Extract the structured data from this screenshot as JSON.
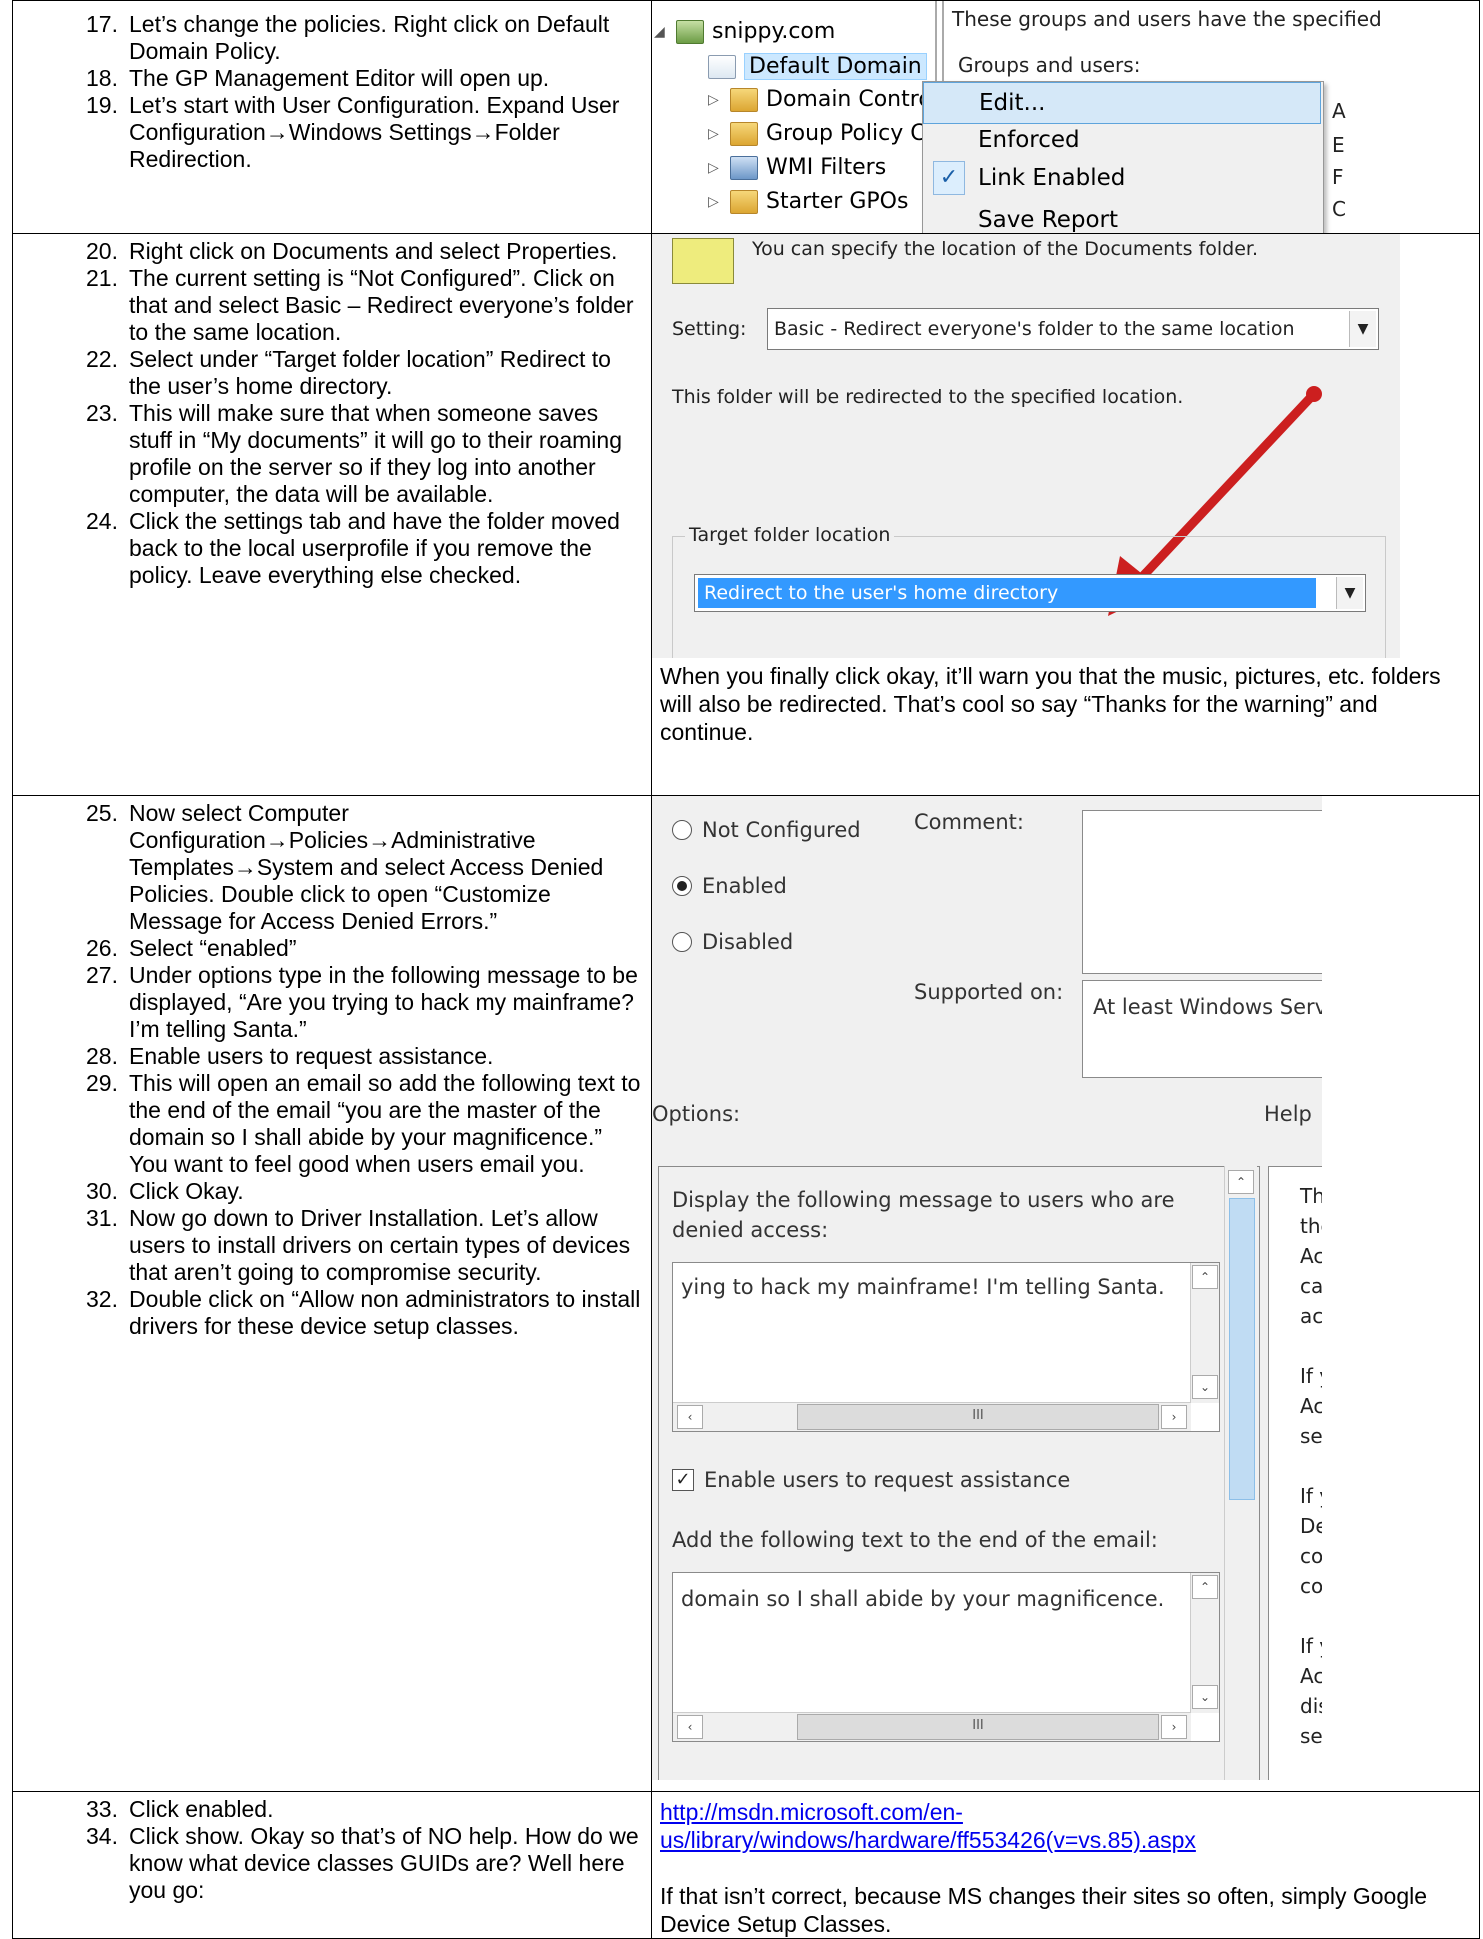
{
  "rows": [
    {
      "steps": [
        {
          "num": "17.",
          "text": "Let’s change the policies. Right click on Default Domain Policy."
        },
        {
          "num": "18.",
          "text": "The GP Management Editor will open up."
        },
        {
          "num": "19.",
          "text": "Let’s start with User Configuration. Expand User Configuration→Windows Settings→Folder Redirection."
        }
      ]
    },
    {
      "steps": [
        {
          "num": "20.",
          "text": "Right click on Documents and select Properties."
        },
        {
          "num": "21.",
          "text": "The current setting is “Not Configured”. Click on that and select Basic – Redirect everyone’s folder to the same location."
        },
        {
          "num": "22.",
          "text": "Select under “Target folder location” Redirect to the user’s home directory."
        },
        {
          "num": "23.",
          "text": "This will make sure that when someone saves stuff in “My documents” it will go to their roaming profile on the server so if they log into another computer, the data will be available."
        },
        {
          "num": "24.",
          "text": "Click the settings tab and have the folder moved back to the local userprofile if you remove the policy. Leave everything else checked."
        }
      ],
      "note": "When you finally click okay, it’ll warn you that the music, pictures, etc. folders will also be redirected. That’s cool so say “Thanks for the warning” and continue."
    },
    {
      "steps": [
        {
          "num": "25.",
          "text": "Now select Computer Configuration→Policies→Administrative Templates→System and select Access Denied Policies. Double click to open “Customize Message for Access Denied Errors.”"
        },
        {
          "num": "26.",
          "text": "Select “enabled”"
        },
        {
          "num": "27.",
          "text": "Under options type in the following message to be displayed, “Are you trying to hack my mainframe? I’m telling Santa.”"
        },
        {
          "num": "28.",
          "text": "Enable users to request assistance."
        },
        {
          "num": "29.",
          "text": "This will open an email so add the following text to the end of the email “you are the master of the domain so I shall abide by your magnificence.” You want to feel good when users email you."
        },
        {
          "num": "30.",
          "text": "Click Okay."
        },
        {
          "num": "31.",
          "text": "Now go down to Driver Installation. Let’s allow users to install drivers on certain types of devices that aren’t going to compromise security."
        },
        {
          "num": "32.",
          "text": "Double click on “Allow non administrators to install drivers for these device setup classes."
        }
      ]
    },
    {
      "steps": [
        {
          "num": "33.",
          "text": "Click enabled."
        },
        {
          "num": "34.",
          "text": "Click show. Okay so that’s of NO help. How do we know what device classes GUIDs are? Well here you go:"
        }
      ],
      "link": "http://msdn.microsoft.com/en-us/library/windows/hardware/ff553426(v=vs.85).aspx",
      "note": "If that isn’t correct, because MS changes their sites so often, simply Google Device Setup Classes."
    }
  ],
  "gpmc": {
    "tree": [
      "snippy.com",
      "Default Domain",
      "Domain Contro",
      "Group Policy C",
      "WMI Filters",
      "Starter GPOs"
    ],
    "right_text": [
      "These groups and users have the specified",
      "Groups and users:"
    ],
    "menu": [
      "Edit...",
      "Enforced",
      "Link Enabled",
      "Save Report"
    ],
    "menu_check": "✓",
    "edge_letters": [
      "A",
      "E",
      "F",
      "C"
    ]
  },
  "redirect": {
    "header": "You can specify the location of the Documents folder.",
    "setting_label": "Setting:",
    "setting_value": "Basic - Redirect everyone's folder to the same location",
    "info": "This folder will be redirected to the specified location.",
    "target_label": "Target folder location",
    "target_value": "Redirect to the user's home directory",
    "accent": "#cc1f1f",
    "highlight": "#3399ff"
  },
  "policy": {
    "radios": [
      "Not Configured",
      "Enabled",
      "Disabled"
    ],
    "comment_label": "Comment:",
    "supported_label": "Supported on:",
    "supported_value": "At least Windows Serv",
    "options_label": "Options:",
    "help_label": "Help",
    "display_label_1": "Display the following message to users who are",
    "display_label_2": "denied access:",
    "message_value": "ying to hack my mainframe! I'm telling Santa.",
    "checkbox_label": "Enable users to request assistance",
    "email_label": "Add the following text to the end of the email:",
    "email_value": "domain so I shall abide by your magnificence.",
    "help_lines": [
      "This",
      "they",
      "Acce",
      "can",
      "acce",
      "",
      "If yo",
      "Acce",
      "setti",
      "",
      "If yo",
      "Deni",
      "cont",
      "conf",
      "",
      "If yo",
      "Acce",
      "disp",
      "see t"
    ]
  }
}
